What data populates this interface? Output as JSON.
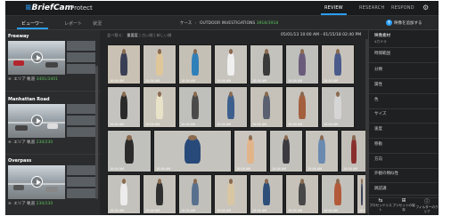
{
  "app": {
    "logo": "BriefCam",
    "logo_mark": "≡",
    "product": "Protect"
  },
  "topnav": {
    "tabs": [
      "REVIEW",
      "RESEARCH",
      "RESPOND"
    ],
    "gear_icon": "gear-icon"
  },
  "subnav": {
    "tabs": [
      "ビューワー",
      "レポート",
      "状況"
    ],
    "breadcrumb": {
      "case": "ケース",
      "investigation": "OUTDOOR INVESTIGATIONS",
      "count": "3918/3918"
    },
    "add_button": "映像を追加する"
  },
  "cameras": [
    {
      "name": "Freeway",
      "meta": "エリア 軌道",
      "count": "3401/3401"
    },
    {
      "name": "Manhattan Road",
      "meta": "エリア 軌道",
      "count": "230/230"
    },
    {
      "name": "Overpass",
      "meta": "エリア 軌道",
      "count": "230/230"
    }
  ],
  "results": {
    "sort_label": "並べ替え：",
    "sort_options": [
      "重要度",
      "古い順",
      "新しい順"
    ],
    "range": "05/01/13 10:00 AM - 01/15/18 02:40 PM",
    "tiles": [
      {
        "color": "#c9c1b3",
        "cloth": "#3a3f55"
      },
      {
        "color": "#c8c3ba",
        "cloth": "#e0c79a"
      },
      {
        "color": "#c5c0b6",
        "cloth": "#2f7fb9"
      },
      {
        "color": "#c6c4bd",
        "cloth": "#f0f0f0"
      },
      {
        "color": "#c4c2bd",
        "cloth": "#3a3a3a"
      },
      {
        "color": "#bfc0bc",
        "cloth": "#6b5b7b"
      },
      {
        "color": "#c7c3bc",
        "cloth": "#4a5a8a"
      },
      {
        "color": "#c5c3bf",
        "cloth": "#2a2a2a"
      },
      {
        "color": "#cac5bb",
        "cloth": "#e8e3c8"
      },
      {
        "color": "#bfbfbb",
        "cloth": "#4a4a4a"
      },
      {
        "color": "#c3c0bb",
        "cloth": "#3c5f8e"
      },
      {
        "color": "#c6c2b9",
        "cloth": "#5a6070"
      },
      {
        "color": "#c8c4be",
        "cloth": "#a45f3d"
      },
      {
        "color": "#c2c1bd",
        "cloth": "#d6d6d6"
      },
      {
        "color": "#c0c0bc",
        "cloth": "#2b2b2b"
      },
      {
        "color": "#c5c3bd",
        "cloth": "#284a7a"
      },
      {
        "color": "#cac6bf",
        "cloth": "#e2b48a"
      },
      {
        "color": "#c3c1bc",
        "cloth": "#3a3a40"
      },
      {
        "color": "#c7c4be",
        "cloth": "#6a8ab0"
      },
      {
        "color": "#c2bfb8",
        "cloth": "#8a2e2e"
      },
      {
        "color": "#c4c2bc",
        "cloth": "#ececec"
      },
      {
        "color": "#c6c3bd",
        "cloth": "#303030"
      },
      {
        "color": "#c1c0bb",
        "cloth": "#58708e"
      },
      {
        "color": "#c8c4bc",
        "cloth": "#d9c7a3"
      },
      {
        "color": "#c4c1bb",
        "cloth": "#2d4f7a"
      },
      {
        "color": "#c6c2ba",
        "cloth": "#474747"
      },
      {
        "color": "#c3c1bb",
        "cloth": "#b35a3a"
      },
      {
        "color": "#c7c3bc",
        "cloth": "#3a3f55"
      },
      {
        "color": "#c2c0ba",
        "cloth": "#7a6a4a"
      },
      {
        "color": "#c6c3bd",
        "cloth": "#f0f0f0"
      },
      {
        "color": "#c4c1bb",
        "cloth": "#2f2f2f"
      },
      {
        "color": "#c8c5bf",
        "cloth": "#4d6d95"
      },
      {
        "color": "#c3c0ba",
        "cloth": "#9a4a3a"
      },
      {
        "color": "#c6c3bc",
        "cloth": "#e3d3b3"
      },
      {
        "color": "#c2c0bb",
        "cloth": "#3a3a3a"
      }
    ],
    "timestamp": "10:04 AM"
  },
  "filters": {
    "items": [
      {
        "label": "映像素材",
        "sub": "4カメラ"
      },
      {
        "label": "時間範囲"
      },
      {
        "label": "分類"
      },
      {
        "label": "属性"
      },
      {
        "label": "色"
      },
      {
        "label": "サイズ"
      },
      {
        "label": "速度"
      },
      {
        "label": "移動"
      },
      {
        "label": "方向"
      },
      {
        "label": "外観の類似性"
      },
      {
        "label": "跳認識"
      }
    ],
    "actions": [
      {
        "icon": "⇆",
        "label": "プロセッドリスト"
      },
      {
        "icon": "⊞",
        "label": "プリセットの保存"
      },
      {
        "icon": "ⓘ",
        "label": "フィルターのクリア"
      }
    ]
  }
}
